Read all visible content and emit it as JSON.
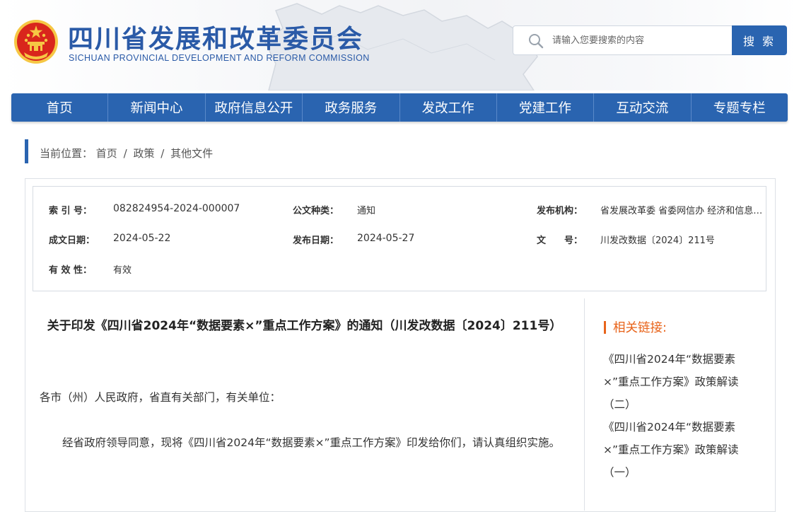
{
  "site": {
    "title": "四川省发展和改革委员会",
    "subtitle": "SICHUAN PROVINCIAL DEVELOPMENT AND REFORM COMMISSION"
  },
  "search": {
    "placeholder": "请输入您要搜索的内容",
    "button_label": "搜 索"
  },
  "nav": {
    "items": [
      "首页",
      "新闻中心",
      "政府信息公开",
      "政务服务",
      "发改工作",
      "党建工作",
      "互动交流",
      "专题专栏"
    ]
  },
  "breadcrumb": {
    "label": "当前位置：",
    "items": [
      "首页",
      "政策",
      "其他文件"
    ],
    "separator": "/"
  },
  "meta": {
    "index_no_label": "索 引 号：",
    "index_no": "082824954-2024-000007",
    "doc_type_label": "公文种类：",
    "doc_type": "通知",
    "publisher_label": "发布机构：",
    "publisher": "省发展改革委 省委网信办 经济和信息化厅",
    "created_label": "成文日期：",
    "created": "2024-05-22",
    "published_label": "发布日期：",
    "published": "2024-05-27",
    "doc_no_label": "文　　号：",
    "doc_no": "川发改数据〔2024〕211号",
    "validity_label": "有 效 性：",
    "validity": "有效"
  },
  "article": {
    "title": "关于印发《四川省2024年“数据要素×”重点工作方案》的通知（川发改数据〔2024〕211号）",
    "salutation": "各市（州）人民政府，省直有关部门，有关单位：",
    "body": "经省政府领导同意，现将《四川省2024年“数据要素×”重点工作方案》印发给你们，请认真组织实施。"
  },
  "related": {
    "title": "相关链接:",
    "links": [
      "《四川省2024年“数据要素×”重点工作方案》政策解读（二）",
      "《四川省2024年“数据要素×”重点工作方案》政策解读（一）"
    ]
  },
  "colors": {
    "brand_blue": "#2a64b0",
    "title_blue": "#2a5aa7",
    "accent_orange": "#e8641b",
    "emblem_red": "#d9261c",
    "emblem_gold": "#f6c744"
  }
}
